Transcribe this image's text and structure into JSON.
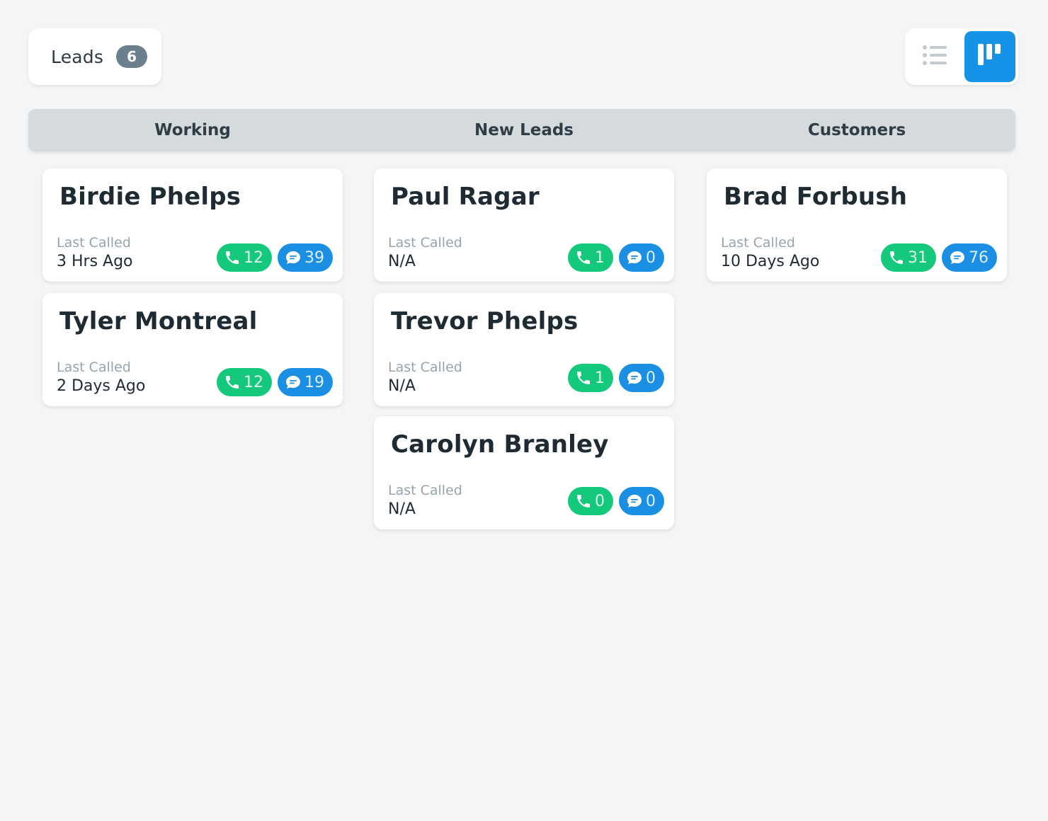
{
  "header": {
    "title": "Leads",
    "count": "6"
  },
  "view_toggle": {
    "list_icon": "list-icon",
    "board_icon": "board-icon",
    "active": "board",
    "active_color": "#1593e6"
  },
  "columns": [
    {
      "label": "Working"
    },
    {
      "label": "New Leads"
    },
    {
      "label": "Customers"
    }
  ],
  "cards": {
    "working": [
      {
        "name": "Birdie Phelps",
        "last_called_label": "Last Called",
        "last_called": "3 Hrs Ago",
        "calls": "12",
        "messages": "39"
      },
      {
        "name": "Tyler Montreal",
        "last_called_label": "Last Called",
        "last_called": "2 Days Ago",
        "calls": "12",
        "messages": "19"
      }
    ],
    "new_leads": [
      {
        "name": "Paul Ragar",
        "last_called_label": "Last Called",
        "last_called": "N/A",
        "calls": "1",
        "messages": "0"
      },
      {
        "name": "Trevor Phelps",
        "last_called_label": "Last Called",
        "last_called": "N/A",
        "calls": "1",
        "messages": "0"
      },
      {
        "name": "Carolyn Branley",
        "last_called_label": "Last Called",
        "last_called": "N/A",
        "calls": "0",
        "messages": "0"
      }
    ],
    "customers": [
      {
        "name": "Brad Forbush",
        "last_called_label": "Last Called",
        "last_called": "10 Days Ago",
        "calls": "31",
        "messages": "76"
      }
    ]
  },
  "colors": {
    "calls_badge": "#14c97c",
    "messages_badge": "#1a8fe3",
    "count_badge": "#6b7f8c",
    "column_bar": "#d5dadd"
  },
  "icons": {
    "calls": "phone-icon",
    "messages": "chat-bubble-icon"
  }
}
